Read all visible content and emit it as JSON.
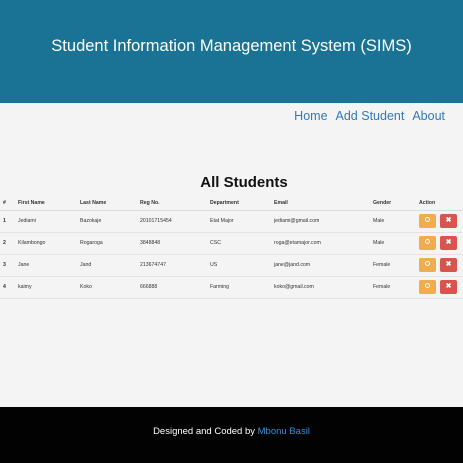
{
  "header": {
    "title": "Student Information Management System (SIMS)"
  },
  "nav": {
    "items": [
      {
        "label": "Home"
      },
      {
        "label": "Add Student"
      },
      {
        "label": "About"
      }
    ]
  },
  "main": {
    "heading": "All Students",
    "table": {
      "columns": [
        "#",
        "First Name",
        "Last Name",
        "Reg No.",
        "Department",
        "Email",
        "Gender",
        "Action"
      ],
      "rows": [
        {
          "no": "1",
          "first": "Jediami",
          "last": "Bazokaje",
          "reg": "20101715454",
          "dept": "Etat Major",
          "email": "jediami@gmail.com",
          "gender": "Male"
        },
        {
          "no": "2",
          "first": "Kilambongo",
          "last": "Rogaroga",
          "reg": "3848848",
          "dept": "CSC",
          "email": "roga@etamajor.com",
          "gender": "Male"
        },
        {
          "no": "3",
          "first": "Jane",
          "last": "Jand",
          "reg": "213674747",
          "dept": "US",
          "email": "jane@jand.com",
          "gender": "Female"
        },
        {
          "no": "4",
          "first": "kaimy",
          "last": "Koko",
          "reg": "666888",
          "dept": "Farming",
          "email": "koko@gmail.com",
          "gender": "Female"
        }
      ]
    },
    "actions": {
      "edit_icon": "edit-icon",
      "delete_icon": "delete-icon",
      "delete_glyph": "✖"
    },
    "colors": {
      "edit": "#f0ad4e",
      "delete": "#d9534f",
      "header_bg": "#1a7394",
      "footer_bg": "#020202",
      "link": "#337ab7"
    }
  },
  "footer": {
    "text": "Designed and Coded by",
    "author": "Mbonu Basil"
  }
}
